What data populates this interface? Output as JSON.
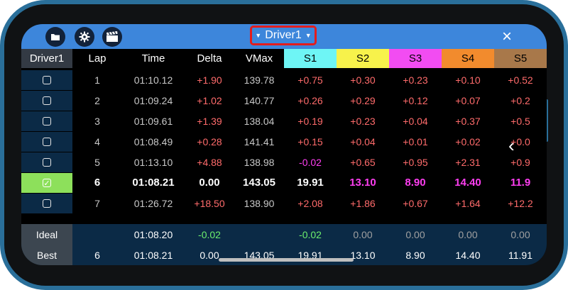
{
  "toolbar": {
    "icons": [
      "folder-icon",
      "gear-icon",
      "clapperboard-icon"
    ],
    "driver_selector": "Driver1",
    "close_icon": "×"
  },
  "columns": [
    "Driver1",
    "Lap",
    "Time",
    "Delta",
    "VMax",
    "S1",
    "S2",
    "S3",
    "S4",
    "S5"
  ],
  "sector_colors": {
    "S1": "#6ef5f5",
    "S2": "#f7f24b",
    "S3": "#f24cf2",
    "S4": "#f28b2d",
    "S5": "#a8784a"
  },
  "laps": [
    {
      "selected": false,
      "lap": "1",
      "time": "01:10.12",
      "delta": "+1.90",
      "vmax": "139.78",
      "s1": "+0.75",
      "s2": "+0.30",
      "s3": "+0.23",
      "s4": "+0.10",
      "s5": "+0.52"
    },
    {
      "selected": false,
      "lap": "2",
      "time": "01:09.24",
      "delta": "+1.02",
      "vmax": "140.77",
      "s1": "+0.26",
      "s2": "+0.29",
      "s3": "+0.12",
      "s4": "+0.07",
      "s5": "+0.2"
    },
    {
      "selected": false,
      "lap": "3",
      "time": "01:09.61",
      "delta": "+1.39",
      "vmax": "138.04",
      "s1": "+0.19",
      "s2": "+0.23",
      "s3": "+0.04",
      "s4": "+0.37",
      "s5": "+0.5"
    },
    {
      "selected": false,
      "lap": "4",
      "time": "01:08.49",
      "delta": "+0.28",
      "vmax": "141.41",
      "s1": "+0.15",
      "s2": "+0.04",
      "s3": "+0.01",
      "s4": "+0.02",
      "s5": "+0.0"
    },
    {
      "selected": false,
      "lap": "5",
      "time": "01:13.10",
      "delta": "+4.88",
      "vmax": "138.98",
      "s1": "-0.02",
      "s2": "+0.65",
      "s3": "+0.95",
      "s4": "+2.31",
      "s5": "+0.9"
    },
    {
      "selected": true,
      "lap": "6",
      "time": "01:08.21",
      "delta": "0.00",
      "vmax": "143.05",
      "s1": "19.91",
      "s2": "13.10",
      "s3": "8.90",
      "s4": "14.40",
      "s5": "11.9"
    },
    {
      "selected": false,
      "lap": "7",
      "time": "01:26.72",
      "delta": "+18.50",
      "vmax": "138.90",
      "s1": "+2.08",
      "s2": "+1.86",
      "s3": "+0.67",
      "s4": "+1.64",
      "s5": "+12.2"
    }
  ],
  "summary": {
    "ideal": {
      "label": "Ideal",
      "lap": "",
      "time": "01:08.20",
      "delta": "-0.02",
      "vmax": "",
      "s1": "-0.02",
      "s2": "0.00",
      "s3": "0.00",
      "s4": "0.00",
      "s5": "0.00"
    },
    "best": {
      "label": "Best",
      "lap": "6",
      "time": "01:08.21",
      "delta": "0.00",
      "vmax": "143.05",
      "s1": "19.91",
      "s2": "13.10",
      "s3": "8.90",
      "s4": "14.40",
      "s5": "11.91"
    }
  },
  "side_chevron": "‹"
}
